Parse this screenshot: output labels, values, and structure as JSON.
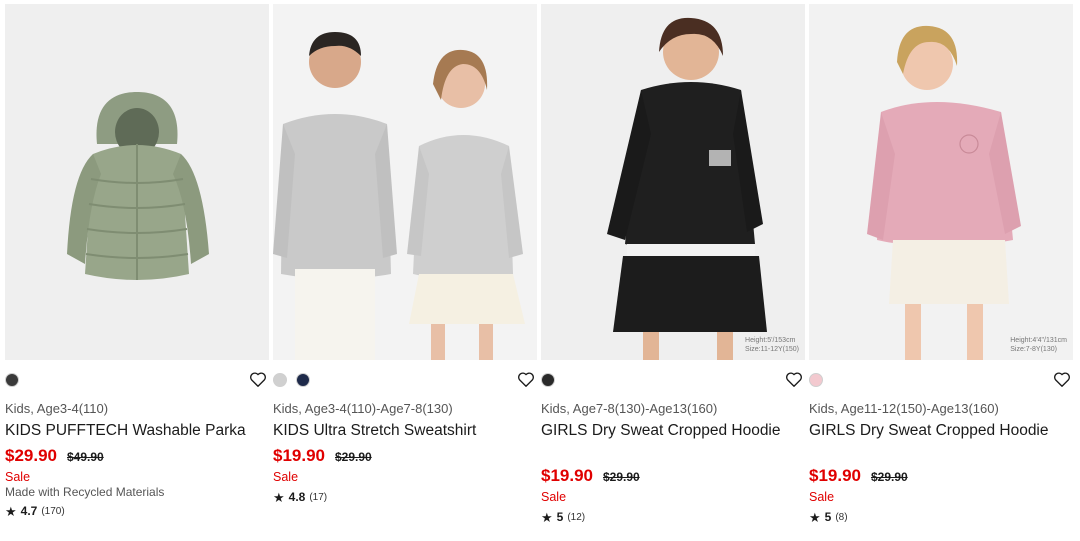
{
  "products": [
    {
      "swatch_colors": [
        "#3a3a3a"
      ],
      "category": "Kids, Age3-4(110)",
      "name": "KIDS PUFFTECH Washable Parka",
      "price": "$29.90",
      "original_price": "$49.90",
      "sale_label": "Sale",
      "note": "Made with Recycled Materials",
      "rating": "4.7",
      "review_count": "(170)",
      "height_note": ""
    },
    {
      "swatch_colors": [
        "#d0d0d0",
        "#1e2a4a"
      ],
      "category": "Kids, Age3-4(110)-Age7-8(130)",
      "name": "KIDS Ultra Stretch Sweatshirt",
      "price": "$19.90",
      "original_price": "$29.90",
      "sale_label": "Sale",
      "note": "",
      "rating": "4.8",
      "review_count": "(17)",
      "height_note": ""
    },
    {
      "swatch_colors": [
        "#2a2a2a"
      ],
      "category": "Kids, Age7-8(130)-Age13(160)",
      "name": "GIRLS Dry Sweat Cropped Hoodie",
      "price": "$19.90",
      "original_price": "$29.90",
      "sale_label": "Sale",
      "note": "",
      "rating": "5",
      "review_count": "(12)",
      "height_note": "Height:5'/153cm\nSize:11-12Y(150)"
    },
    {
      "swatch_colors": [
        "#f3c9cf"
      ],
      "category": "Kids, Age11-12(150)-Age13(160)",
      "name": "GIRLS Dry Sweat Cropped Hoodie",
      "price": "$19.90",
      "original_price": "$29.90",
      "sale_label": "Sale",
      "note": "",
      "rating": "5",
      "review_count": "(8)",
      "height_note": "Height:4'4\"/131cm\nSize:7-8Y(130)"
    }
  ],
  "icons": {
    "favorite": "heart-outline-icon",
    "star": "star-icon"
  }
}
